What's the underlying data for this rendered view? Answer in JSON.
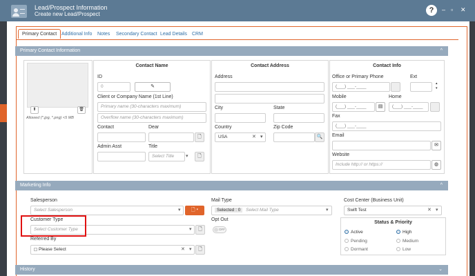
{
  "window": {
    "title": "Lead/Prospect Information",
    "subtitle": "Create new Lead/Prospect",
    "help_label": "?",
    "minimize": "‒",
    "maximize": "▫",
    "close": "✕"
  },
  "tabs": [
    "Primary Contact",
    "Additional Info",
    "Notes",
    "Secondary Contact",
    "Lead Details",
    "CRM"
  ],
  "sections": {
    "primary": "Primary Contact Information",
    "marketing": "Marketing Info",
    "history": "History",
    "chevron_up": "^",
    "chevron_down": "⌄"
  },
  "photo": {
    "hint": "Allowed (*.jpg, *.png) <5 MB"
  },
  "contact_name": {
    "title": "Contact Name",
    "id_label": "ID",
    "id_value": "0",
    "company_label": "Client or Company Name (1st Line)",
    "primary_placeholder": "Primary name (30-characters maximum)",
    "overflow_placeholder": "Overflow name (30-characters maximum)",
    "contact_label": "Contact",
    "dear_label": "Dear",
    "admin_label": "Admin Asst",
    "title_label": "Title",
    "title_placeholder": "Select Title"
  },
  "contact_address": {
    "title": "Contact Address",
    "address_label": "Address",
    "city_label": "City",
    "state_label": "State",
    "country_label": "Country",
    "country_value": "USA",
    "zip_label": "Zip Code"
  },
  "contact_info": {
    "title": "Contact Info",
    "office_label": "Office or Primary Phone",
    "ext_label": "Ext",
    "phone_mask": "(___) ___-____",
    "mobile_label": "Mobile",
    "home_label": "Home",
    "fax_label": "Fax",
    "email_label": "Email",
    "website_label": "Website",
    "website_placeholder": "Include http:// or https://"
  },
  "marketing": {
    "salesperson_label": "Salesperson",
    "salesperson_placeholder": "Select Salesperson",
    "customer_type_label": "Customer Type",
    "customer_type_placeholder": "Select Customer Type",
    "referred_label": "Referred By",
    "referred_value": "Please Select",
    "mail_type_label": "Mail Type",
    "mail_selected": "Selected : 0",
    "mail_placeholder": "Select Mail Type",
    "opt_out_label": "Opt Out",
    "opt_out_state": "OFF",
    "cost_center_label": "Cost Center (Business Unit)",
    "cost_center_value": "Swift Test",
    "status_priority_title": "Status & Priority",
    "status": [
      "Active",
      "Pending",
      "Dormant"
    ],
    "priority": [
      "High",
      "Medium",
      "Low"
    ]
  },
  "icons": {
    "clear": "✕",
    "caret": "▾",
    "search": "🔍",
    "upload": "⬆",
    "trash": "🗑",
    "edit": "✎",
    "mail": "✉",
    "globe": "◍",
    "sms": "▤",
    "spin_up": "▴",
    "spin_down": "▾",
    "doc": "🗋"
  },
  "colors": {
    "titlebar": "#5c7a94",
    "accent": "#e0642a",
    "section": "#96aabd",
    "highlight": "#e01010"
  }
}
